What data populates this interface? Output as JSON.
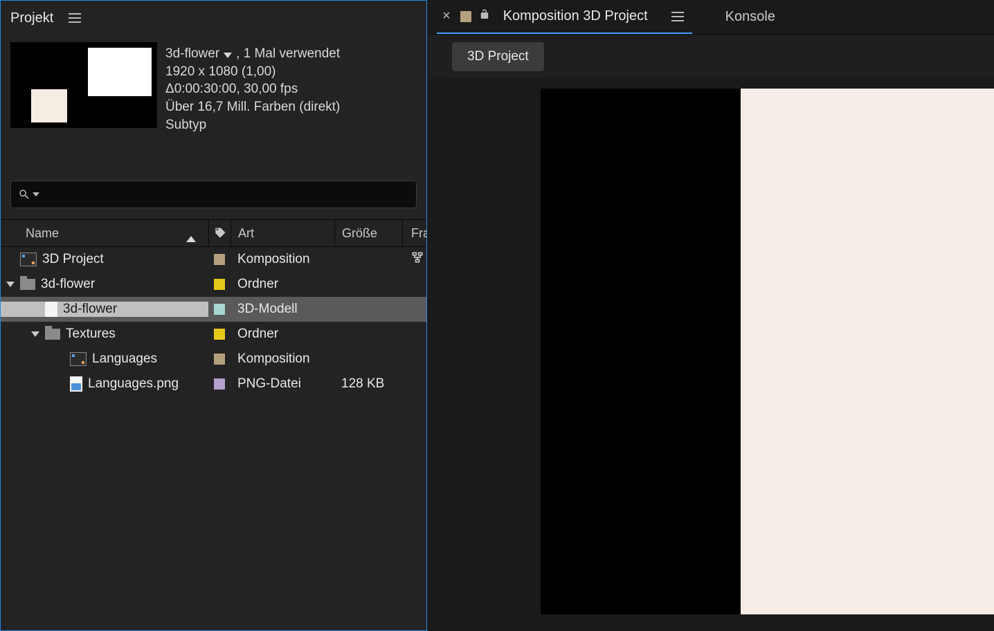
{
  "left": {
    "panel_tab": "Projekt",
    "info": {
      "name": "3d-flower",
      "usage": ", 1 Mal verwendet",
      "dims": "1920 x 1080 (1,00)",
      "dur": "Δ0:00:30:00, 30,00 fps",
      "colors": "Über 16,7 Mill. Farben (direkt)",
      "subtype": "Subtyp"
    },
    "search_placeholder": "",
    "columns": {
      "name": "Name",
      "art": "Art",
      "size": "Größe",
      "fra": "Fra"
    },
    "rows": [
      {
        "indent": 0,
        "disclosure": "",
        "icon": "comp",
        "name": "3D Project",
        "swatch": "sand",
        "art": "Komposition",
        "size": "",
        "flow": true,
        "selected": false
      },
      {
        "indent": 0,
        "disclosure": "down",
        "icon": "folder",
        "name": "3d-flower",
        "swatch": "yellow",
        "art": "Ordner",
        "size": "",
        "flow": false,
        "selected": false
      },
      {
        "indent": 1,
        "disclosure": "",
        "icon": "file",
        "name": "3d-flower",
        "swatch": "aqua",
        "art": "3D-Modell",
        "size": "",
        "flow": false,
        "selected": true
      },
      {
        "indent": 1,
        "disclosure": "down",
        "icon": "folder",
        "name": "Textures",
        "swatch": "yellow",
        "art": "Ordner",
        "size": "",
        "flow": false,
        "selected": false
      },
      {
        "indent": 2,
        "disclosure": "",
        "icon": "comp",
        "name": "Languages",
        "swatch": "sand",
        "art": "Komposition",
        "size": "",
        "flow": false,
        "selected": false
      },
      {
        "indent": 2,
        "disclosure": "",
        "icon": "png",
        "name": "Languages.png",
        "swatch": "lav",
        "art": "PNG-Datei",
        "size": "128 KB",
        "flow": false,
        "selected": false
      }
    ]
  },
  "right": {
    "tab_title": "Komposition 3D Project",
    "konsole": "Konsole",
    "chip": "3D Project"
  }
}
